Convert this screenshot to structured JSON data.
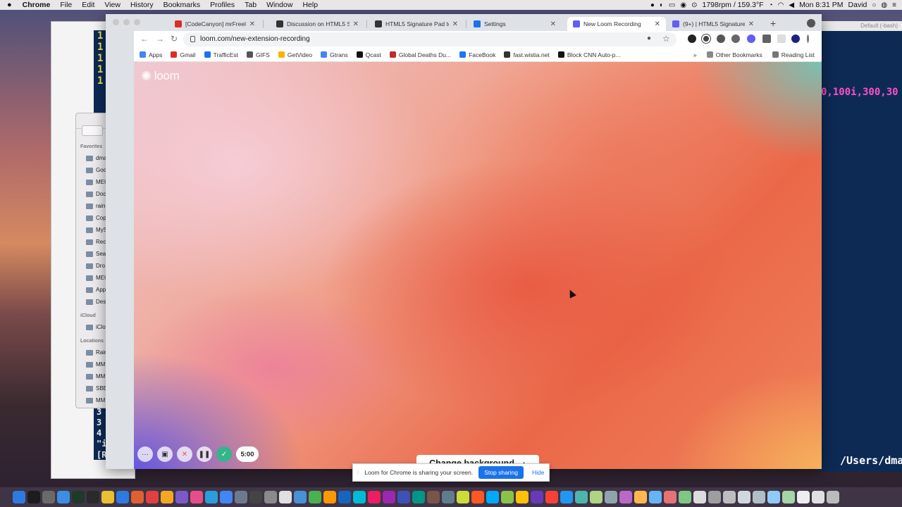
{
  "menubar": {
    "apple": "",
    "app": "Chrome",
    "items": [
      "File",
      "Edit",
      "View",
      "History",
      "Bookmarks",
      "Profiles",
      "Tab",
      "Window",
      "Help"
    ],
    "status_readout": "1798rpm / 159.3°F",
    "clock": "Mon 8:31 PM",
    "user": "David"
  },
  "terminal_left": {
    "lines": [
      "1",
      "1",
      "1",
      "1",
      "1"
    ],
    "bottom_lines": [
      "3",
      "3",
      "4",
      "\"i",
      "[Ra"
    ]
  },
  "terminal_right": {
    "title": "Default (-bash)",
    "text": "0,100i,300,30",
    "path": "/Users/dma"
  },
  "finder": {
    "favorites_header": "Favorites",
    "favorites": [
      "dma",
      "Goo",
      "MEG",
      "Doc",
      "rain",
      "Cop",
      "MyS",
      "Rec",
      "Sea",
      "Dro",
      "MEG",
      "App",
      "Des"
    ],
    "icloud_header": "iCloud",
    "icloud": [
      "iClo"
    ],
    "locations_header": "Locations",
    "locations": [
      "Rain",
      "MM",
      "MM",
      "SBE",
      "MM"
    ]
  },
  "chrome": {
    "tabs": [
      {
        "title": "[CodeCanyon] mrFreelan...",
        "favicon": "gmail-icon",
        "color": "#d93025",
        "active": false
      },
      {
        "title": "Discussion on HTML5 Sig...",
        "favicon": "codecanyon-icon",
        "color": "#333333",
        "active": false
      },
      {
        "title": "HTML5 Signature Pad to I...",
        "favicon": "codecanyon-icon",
        "color": "#333333",
        "active": false
      },
      {
        "title": "Settings",
        "favicon": "gear-icon",
        "color": "#1a73e8",
        "active": false
      },
      {
        "title": "New Loom Recording",
        "favicon": "loom-icon",
        "color": "#625df5",
        "active": true
      },
      {
        "title": "(9+) | HTML5 Signature P...",
        "favicon": "loom-icon",
        "color": "#625df5",
        "active": false
      }
    ],
    "url": "loom.com/new-extension-recording",
    "bookmarks": [
      {
        "label": "Apps",
        "color": "#4285f4"
      },
      {
        "label": "Gmail",
        "color": "#d93025"
      },
      {
        "label": "TrafficEst",
        "color": "#1a73e8"
      },
      {
        "label": "GIFS",
        "color": "#555555"
      },
      {
        "label": "GetVideo",
        "color": "#f4b400"
      },
      {
        "label": "Gtrans",
        "color": "#4285f4"
      },
      {
        "label": "Qcast",
        "color": "#111111"
      },
      {
        "label": "Global Deaths Du...",
        "color": "#c62828"
      },
      {
        "label": "FaceBook",
        "color": "#1877f2"
      },
      {
        "label": "fast.wistia.net",
        "color": "#333333"
      },
      {
        "label": "Block CNN Auto-p...",
        "color": "#111111"
      }
    ],
    "bookmarks_more": "»",
    "other_bookmarks": "Other Bookmarks",
    "reading_list": "Reading List"
  },
  "loom": {
    "logo_text": "loom",
    "timer": "5:00",
    "change_background": "Change background"
  },
  "share_bar": {
    "message": "Loom for Chrome is sharing your screen.",
    "stop": "Stop sharing",
    "hide": "Hide"
  }
}
